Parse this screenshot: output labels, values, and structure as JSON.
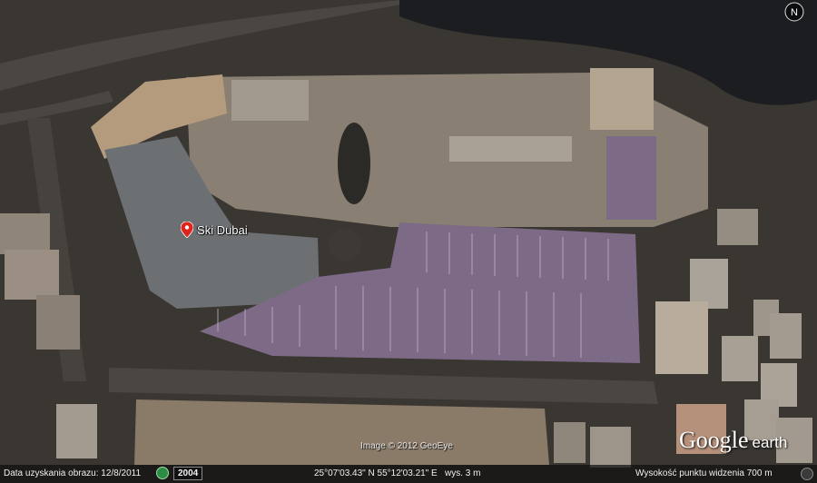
{
  "placemark": {
    "label": "Ski Dubai",
    "icon": "red-pin-icon"
  },
  "compass": {
    "label": "N",
    "icon": "compass-icon"
  },
  "imagery_credit": "Image © 2012 GeoEye",
  "logo": {
    "word1": "Google",
    "word2": "earth"
  },
  "status_bar": {
    "imagery_date": "Data uzyskania obrazu: 12/8/2011",
    "historical_icon": "historical-imagery-clock-icon",
    "year": "2004",
    "coordinates": "25°07'03.43\" N   55°12'03.21\" E",
    "elevation": "wys.       3 m",
    "eye_altitude": "Wysokość punktu widzenia       700 m"
  },
  "colors": {
    "ground": "#3a3631",
    "roof": "#8a7f73",
    "ski_slope": "#6c7073",
    "parking": "#7d6a86",
    "water": "#1b1d20",
    "road": "#4a4641",
    "sand_lot": "#8a7a68",
    "pin": "#e0241b"
  }
}
